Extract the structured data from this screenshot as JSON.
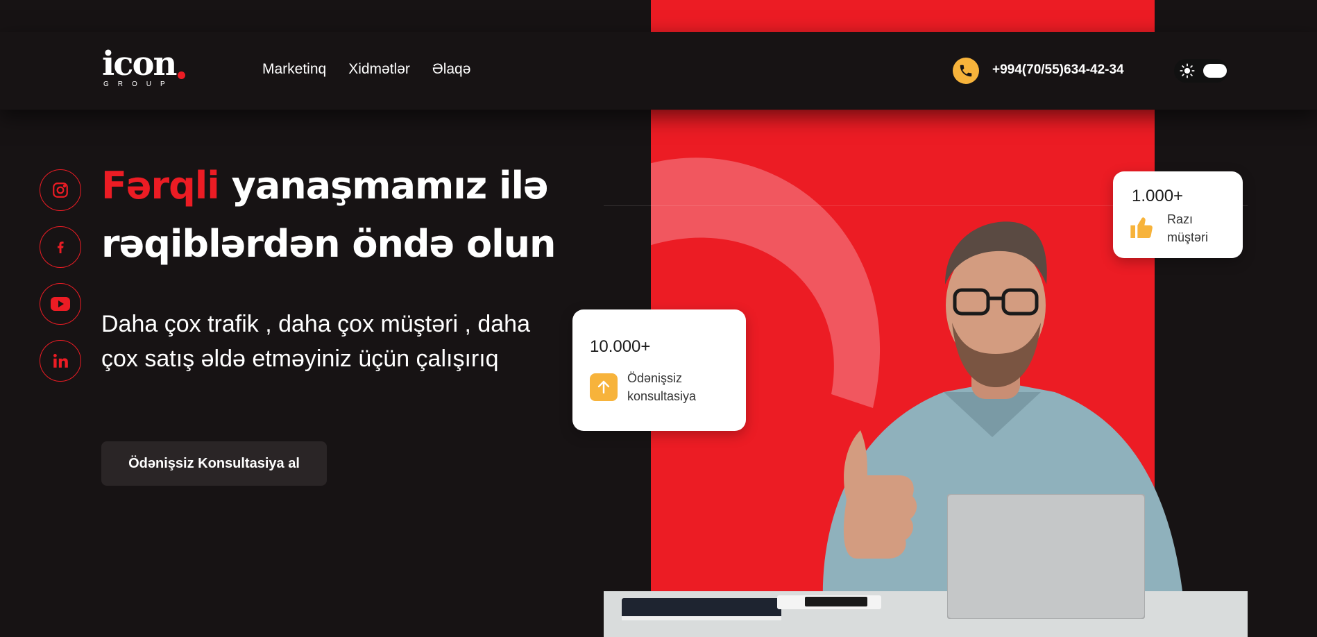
{
  "brand": {
    "logo_word": "icon",
    "logo_sub": "GROUP"
  },
  "nav": {
    "items": [
      {
        "label": "Marketinq"
      },
      {
        "label": "Xidmətlər"
      },
      {
        "label": "Əlaqə"
      }
    ]
  },
  "contact": {
    "phone": "+994(70/55)634-42-34"
  },
  "hero": {
    "headline_accent": "Fərqli",
    "headline_rest": "yanaşmamız ilə rəqiblərdən öndə olun",
    "subtext": "Daha çox trafik , daha çox müştəri , daha çox satış əldə etməyiniz üçün çalışırıq",
    "cta_label": "Ödənişsiz Konsultasiya al"
  },
  "social": [
    {
      "icon": "instagram-icon"
    },
    {
      "icon": "facebook-icon"
    },
    {
      "icon": "youtube-icon"
    },
    {
      "icon": "linkedin-icon"
    }
  ],
  "stats": [
    {
      "value": "10.000+",
      "label": "Ödənişsiz konsultasiya",
      "icon": "arrow-up-icon"
    },
    {
      "value": "1.000+",
      "label": "Razı müştəri",
      "icon": "thumbs-up-icon"
    }
  ],
  "colors": {
    "background": "#171314",
    "accent_red": "#ec1c24",
    "accent_yellow": "#f7b33b",
    "card_bg": "#ffffff"
  }
}
